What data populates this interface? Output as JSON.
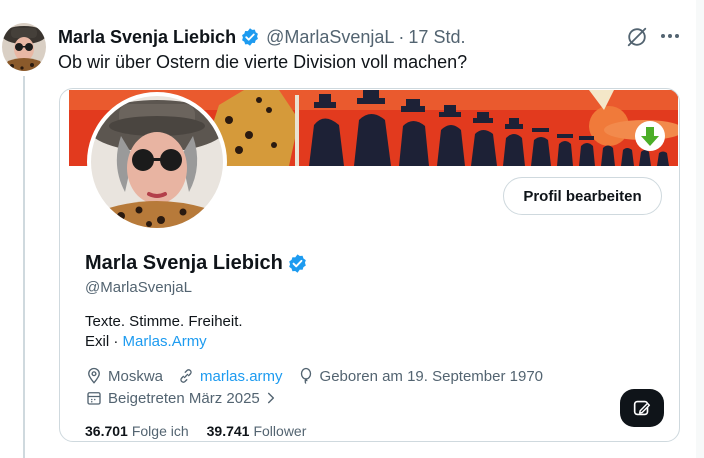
{
  "post": {
    "author_name": "Marla Svenja Liebich",
    "author_handle": "@MarlaSvenjaL",
    "separator": "·",
    "time": "17 Std.",
    "text": "Ob wir über Ostern die vierte Division voll machen?"
  },
  "card": {
    "edit_profile_label": "Profil bearbeiten",
    "display_name": "Marla Svenja Liebich",
    "handle": "@MarlaSvenjaL",
    "bio_line1": "Texte. Stimme. Freiheit.",
    "bio_line2_prefix": "Exil ·",
    "bio_line2_link": "Marlas.Army",
    "location": "Moskwa",
    "website": "marlas.army",
    "birthday": "Geboren am 19. September 1970",
    "joined": "Beigetreten März 2025",
    "following_count": "36.701",
    "following_label": "Folge ich",
    "followers_count": "39.741",
    "followers_label": "Follower"
  },
  "icons": {
    "verified": "verified-badge-icon",
    "grok": "grok-icon",
    "more": "more-icon",
    "location": "location-pin-icon",
    "link": "link-icon",
    "birthday": "balloon-icon",
    "calendar": "calendar-icon",
    "chevron": "chevron-right-icon",
    "download": "download-arrow-icon",
    "fab": "compose-icon"
  },
  "colors": {
    "accent": "#1d9bf0",
    "text": "#0f1419",
    "muted": "#536471",
    "border": "#cfd9de",
    "banner_red": "#e23a1e",
    "download_green": "#4cae28"
  }
}
